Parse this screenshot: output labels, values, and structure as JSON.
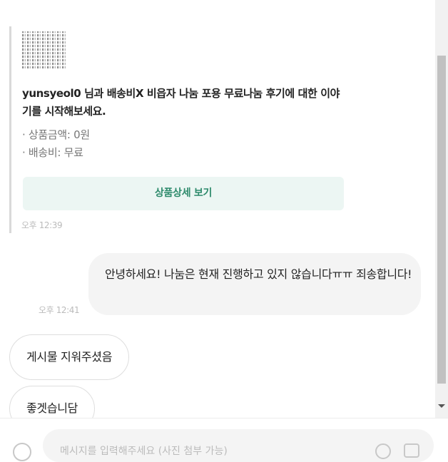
{
  "product_card": {
    "title": "yunsyeol0 님과 배송비X 비읍자 나눔 포용 무료나눔 후기에 대한 이야기를 시작해보세요.",
    "price": "· 상품금액: 0원",
    "shipping": "· 배송비: 무료",
    "detail_button": "상품상세 보기",
    "time": "오후 12:39"
  },
  "messages": {
    "sent_1": {
      "text": "안녕하세요! 나눔은 현재 진행하고 있지 않습니다ㅠㅠ 죄송합니다!",
      "time": "오후 12:41"
    },
    "received_1": "게시물 지워주셨음",
    "received_2": "좋겟습니담"
  },
  "composer": {
    "placeholder": "메시지를 입력해주세요 (사진 첨부 가능)"
  },
  "icons": [
    "attach-icon",
    "emoji-icon",
    "camera-icon",
    "scroll-down-arrow-icon"
  ],
  "colors": {
    "button_bg": "#ecf6f3",
    "button_text": "#2d8a6b",
    "sent_bubble": "#f4f4f4"
  }
}
